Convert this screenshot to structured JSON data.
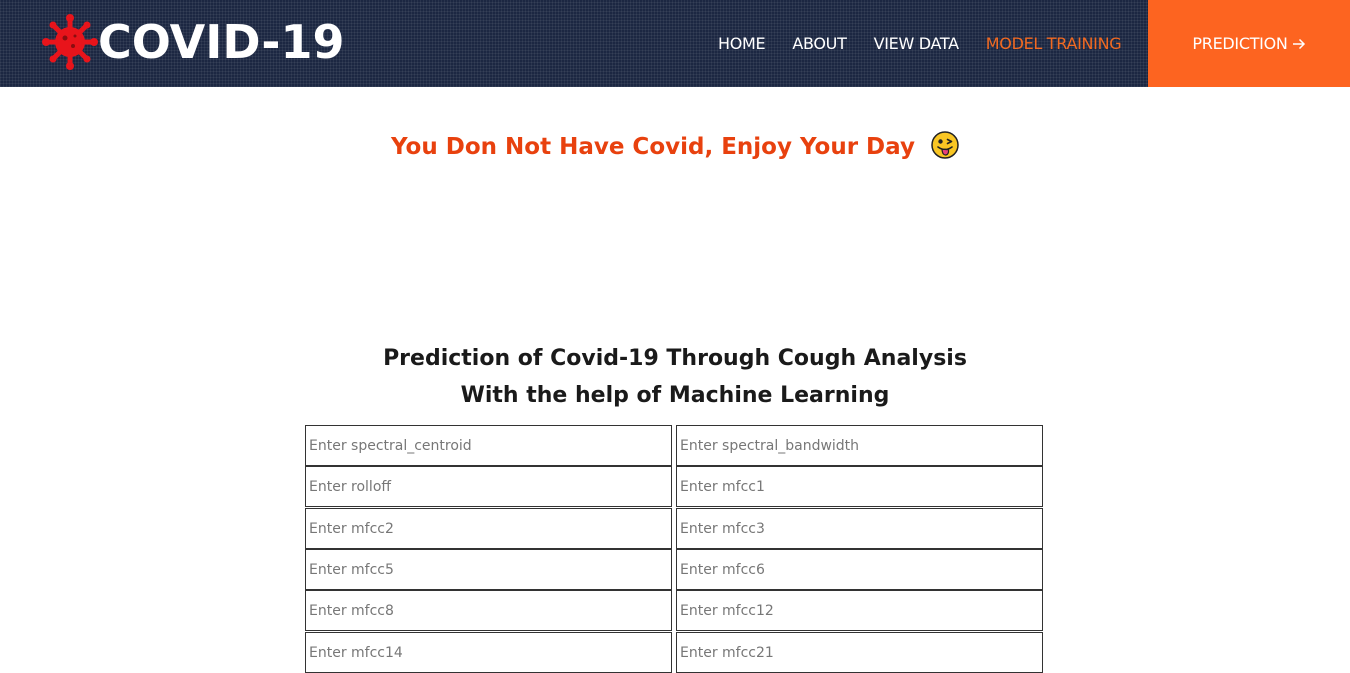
{
  "header": {
    "logo_text": "COVID-19",
    "logo_icon": "virus-icon",
    "nav": [
      {
        "label": "HOME",
        "active": false
      },
      {
        "label": "ABOUT",
        "active": false
      },
      {
        "label": "VIEW DATA",
        "active": false
      },
      {
        "label": "MODEL TRAINING",
        "active": true
      }
    ],
    "cta": {
      "label": "PREDICTION",
      "icon": "arrow-right-icon"
    }
  },
  "result": {
    "message": "You Don Not Have Covid, Enjoy Your Day",
    "emoji": "winking-face-with-tongue-icon"
  },
  "heading": {
    "line1": "Prediction of Covid-19 Through Cough Analysis",
    "line2": "With the help of Machine Learning"
  },
  "form": {
    "fields": [
      {
        "placeholder": "Enter spectral_centroid",
        "value": ""
      },
      {
        "placeholder": "Enter spectral_bandwidth",
        "value": ""
      },
      {
        "placeholder": "Enter rolloff",
        "value": ""
      },
      {
        "placeholder": "Enter mfcc1",
        "value": ""
      },
      {
        "placeholder": "Enter mfcc2",
        "value": ""
      },
      {
        "placeholder": "Enter mfcc3",
        "value": ""
      },
      {
        "placeholder": "Enter mfcc5",
        "value": ""
      },
      {
        "placeholder": "Enter mfcc6",
        "value": ""
      },
      {
        "placeholder": "Enter mfcc8",
        "value": ""
      },
      {
        "placeholder": "Enter mfcc12",
        "value": ""
      },
      {
        "placeholder": "Enter mfcc14",
        "value": ""
      },
      {
        "placeholder": "Enter mfcc21",
        "value": ""
      }
    ]
  },
  "colors": {
    "nav_bg": "#1c2742",
    "accent": "#fd6420",
    "active_link": "#f26a21",
    "result_text": "#e8410e",
    "virus": "#e8141b"
  }
}
